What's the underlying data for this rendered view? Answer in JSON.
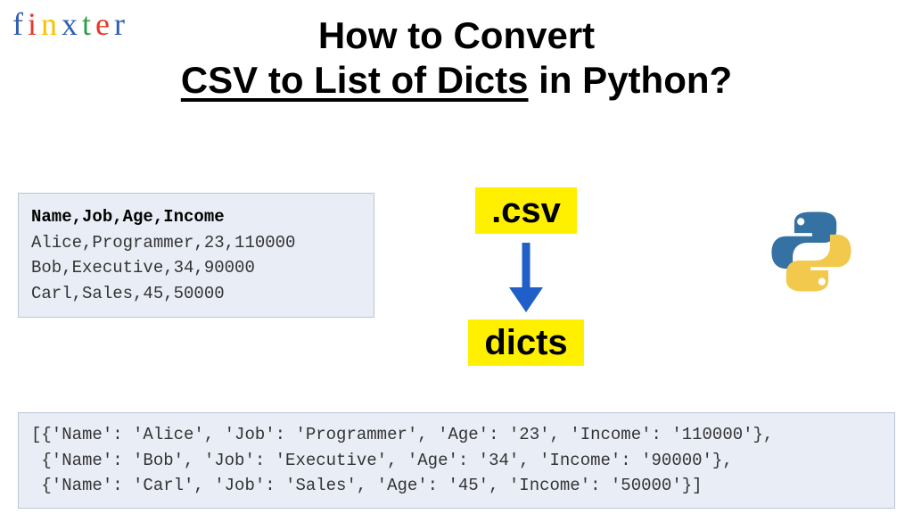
{
  "logo": {
    "f": "f",
    "i": "i",
    "n": "n",
    "x": "x",
    "t": "t",
    "e": "e",
    "r": "r"
  },
  "title": {
    "line1": "How to Convert",
    "underline": "CSV to List of Dicts",
    "rest": " in Python?"
  },
  "csv": {
    "header": "Name,Job,Age,Income",
    "row1": "Alice,Programmer,23,110000",
    "row2": "Bob,Executive,34,90000",
    "row3": "Carl,Sales,45,50000"
  },
  "flow": {
    "top_badge": ".csv",
    "bottom_badge": "dicts"
  },
  "output": {
    "line1": "[{'Name': 'Alice', 'Job': 'Programmer', 'Age': '23', 'Income': '110000'},",
    "line2": " {'Name': 'Bob', 'Job': 'Executive', 'Age': '34', 'Income': '90000'},",
    "line3": " {'Name': 'Carl', 'Job': 'Sales', 'Age': '45', 'Income': '50000'}]"
  }
}
